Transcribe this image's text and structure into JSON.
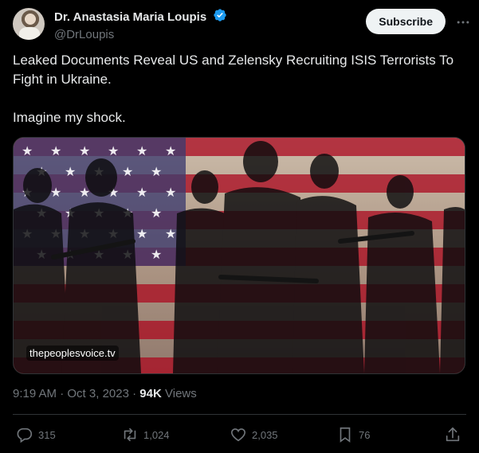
{
  "author": {
    "display_name": "Dr. Anastasia Maria Loupis",
    "handle": "@DrLoupis",
    "verified": true
  },
  "subscribe_label": "Subscribe",
  "tweet_text": "Leaked Documents Reveal US and Zelensky Recruiting ISIS Terrorists To Fight in Ukraine.\n\nImagine my shock.",
  "media": {
    "source_label": "thepeoplesvoice.tv"
  },
  "meta": {
    "time": "9:19 AM",
    "separator": "·",
    "date": "Oct 3, 2023",
    "views_count": "94K",
    "views_label": "Views"
  },
  "actions": {
    "replies": "315",
    "reposts": "1,024",
    "likes": "2,035",
    "bookmarks": "76"
  },
  "colors": {
    "accent_verified": "#1d9bf0",
    "text_secondary": "#71767b",
    "flag_red": "#b22234",
    "flag_blue": "#3c3b6e"
  }
}
